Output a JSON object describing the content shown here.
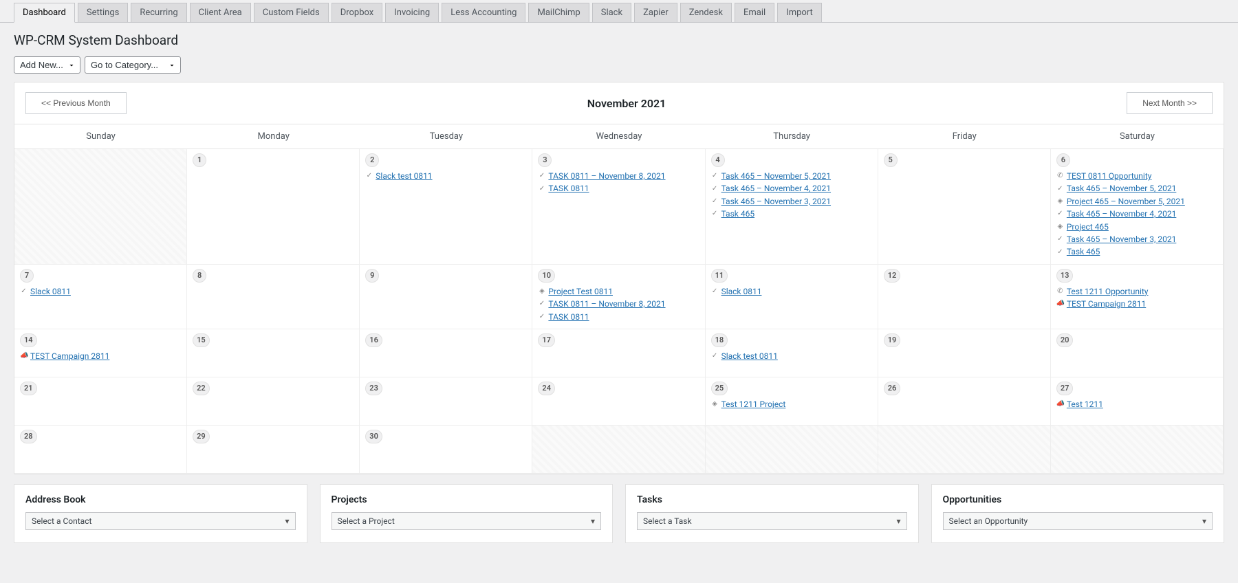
{
  "tabs": [
    "Dashboard",
    "Settings",
    "Recurring",
    "Client Area",
    "Custom Fields",
    "Dropbox",
    "Invoicing",
    "Less Accounting",
    "MailChimp",
    "Slack",
    "Zapier",
    "Zendesk",
    "Email",
    "Import"
  ],
  "active_tab": 0,
  "page_title": "WP-CRM System Dashboard",
  "controls": {
    "add_new": "Add New...",
    "go_category": "Go to Category..."
  },
  "calendar": {
    "prev_label": "<< Previous Month",
    "next_label": "Next Month >>",
    "title": "November 2021",
    "weekdays": [
      "Sunday",
      "Monday",
      "Tuesday",
      "Wednesday",
      "Thursday",
      "Friday",
      "Saturday"
    ],
    "rows": [
      [
        {
          "disabled": true
        },
        {
          "num": "1"
        },
        {
          "num": "2",
          "events": [
            {
              "icon": "check",
              "label": "Slack test 0811"
            }
          ]
        },
        {
          "num": "3",
          "events": [
            {
              "icon": "check",
              "label": "TASK 0811 – November 8, 2021"
            },
            {
              "icon": "check",
              "label": "TASK 0811"
            }
          ]
        },
        {
          "num": "4",
          "events": [
            {
              "icon": "check",
              "label": "Task 465 – November 5, 2021"
            },
            {
              "icon": "check",
              "label": "Task 465 – November 4, 2021"
            },
            {
              "icon": "check",
              "label": "Task 465 – November 3, 2021"
            },
            {
              "icon": "check",
              "label": "Task 465"
            }
          ]
        },
        {
          "num": "5"
        },
        {
          "num": "6",
          "events": [
            {
              "icon": "phone",
              "label": "TEST 0811 Opportunity"
            },
            {
              "icon": "check",
              "label": "Task 465 – November 5, 2021"
            },
            {
              "icon": "diamond",
              "label": "Project 465 – November 5, 2021"
            },
            {
              "icon": "check",
              "label": "Task 465 – November 4, 2021"
            },
            {
              "icon": "diamond",
              "label": "Project 465"
            },
            {
              "icon": "check",
              "label": "Task 465 – November 3, 2021"
            },
            {
              "icon": "check",
              "label": "Task 465"
            }
          ]
        }
      ],
      [
        {
          "num": "7",
          "events": [
            {
              "icon": "check",
              "label": "Slack 0811"
            }
          ]
        },
        {
          "num": "8"
        },
        {
          "num": "9"
        },
        {
          "num": "10",
          "events": [
            {
              "icon": "diamond",
              "label": "Project Test 0811"
            },
            {
              "icon": "check",
              "label": "TASK 0811 – November 8, 2021"
            },
            {
              "icon": "check",
              "label": "TASK 0811"
            }
          ]
        },
        {
          "num": "11",
          "events": [
            {
              "icon": "check",
              "label": "Slack 0811"
            }
          ]
        },
        {
          "num": "12"
        },
        {
          "num": "13",
          "events": [
            {
              "icon": "phone",
              "label": "Test 1211 Opportunity"
            },
            {
              "icon": "bullhorn",
              "label": "TEST Campaign 2811"
            }
          ]
        }
      ],
      [
        {
          "num": "14",
          "events": [
            {
              "icon": "bullhorn",
              "label": "TEST Campaign 2811"
            }
          ]
        },
        {
          "num": "15"
        },
        {
          "num": "16"
        },
        {
          "num": "17"
        },
        {
          "num": "18",
          "events": [
            {
              "icon": "check",
              "label": "Slack test 0811"
            }
          ]
        },
        {
          "num": "19"
        },
        {
          "num": "20"
        }
      ],
      [
        {
          "num": "21"
        },
        {
          "num": "22"
        },
        {
          "num": "23"
        },
        {
          "num": "24"
        },
        {
          "num": "25",
          "events": [
            {
              "icon": "diamond",
              "label": "Test 1211 Project"
            }
          ]
        },
        {
          "num": "26"
        },
        {
          "num": "27",
          "events": [
            {
              "icon": "bullhorn",
              "label": "Test 1211"
            }
          ]
        }
      ],
      [
        {
          "num": "28"
        },
        {
          "num": "29"
        },
        {
          "num": "30"
        },
        {
          "disabled": true
        },
        {
          "disabled": true
        },
        {
          "disabled": true
        },
        {
          "disabled": true
        }
      ]
    ]
  },
  "panels": [
    {
      "title": "Address Book",
      "placeholder": "Select a Contact"
    },
    {
      "title": "Projects",
      "placeholder": "Select a Project"
    },
    {
      "title": "Tasks",
      "placeholder": "Select a Task"
    },
    {
      "title": "Opportunities",
      "placeholder": "Select an Opportunity"
    }
  ],
  "icons": {
    "check": "✓",
    "phone": "✆",
    "diamond": "◈",
    "bullhorn": "📣"
  }
}
